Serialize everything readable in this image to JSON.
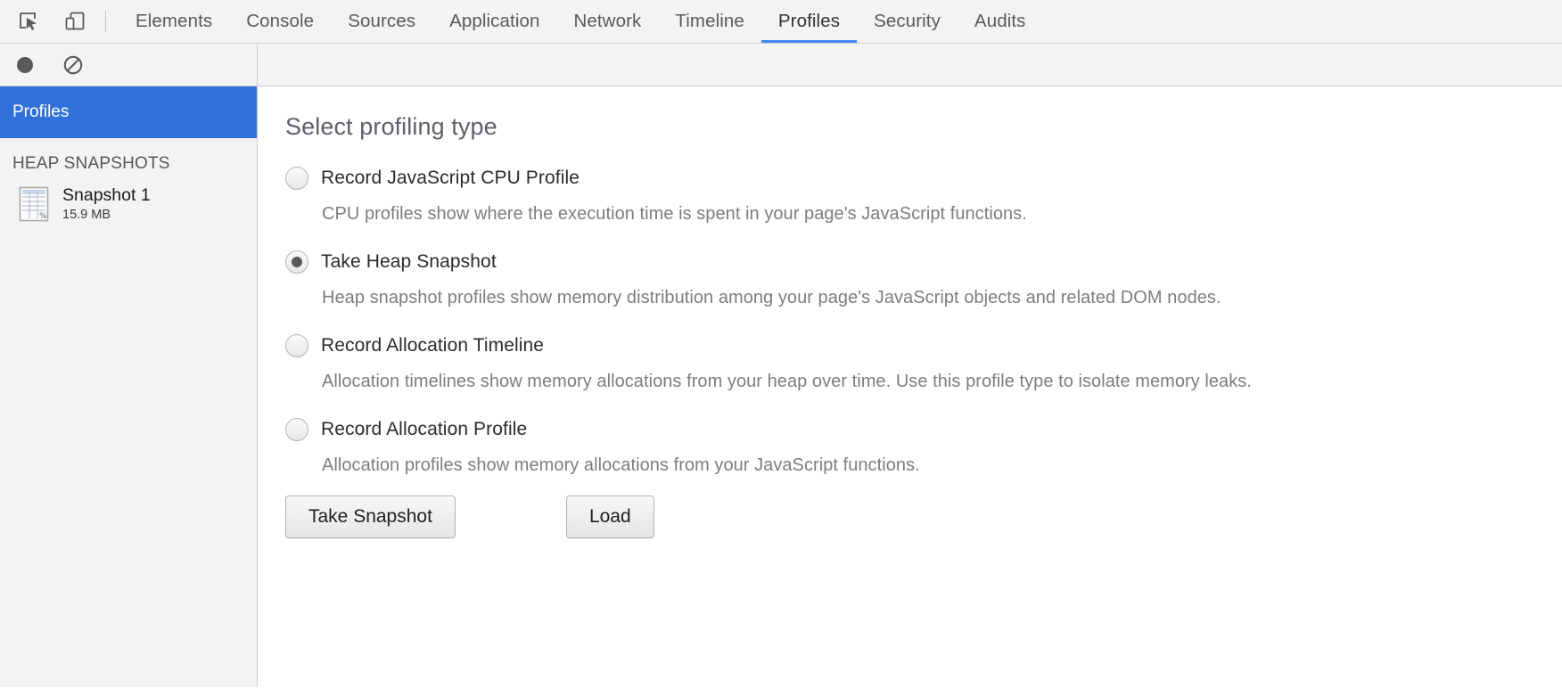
{
  "toolbar": {
    "inspect_icon": "inspect-element-icon",
    "device_icon": "toggle-device-toolbar-icon",
    "tabs": [
      {
        "label": "Elements",
        "active": false
      },
      {
        "label": "Console",
        "active": false
      },
      {
        "label": "Sources",
        "active": false
      },
      {
        "label": "Application",
        "active": false
      },
      {
        "label": "Network",
        "active": false
      },
      {
        "label": "Timeline",
        "active": false
      },
      {
        "label": "Profiles",
        "active": true
      },
      {
        "label": "Security",
        "active": false
      },
      {
        "label": "Audits",
        "active": false
      }
    ],
    "active_tab_accent": "#4285f4"
  },
  "subtoolbar": {
    "record_icon": "record-circle-icon",
    "clear_icon": "clear-all-icon"
  },
  "sidebar": {
    "header_label": "Profiles",
    "header_color": "#3072d9",
    "section_label": "HEAP SNAPSHOTS",
    "items": [
      {
        "icon": "heap-snapshot-icon",
        "title": "Snapshot 1",
        "size": "15.9 MB"
      }
    ]
  },
  "main": {
    "title": "Select profiling type",
    "options": [
      {
        "label": "Record JavaScript CPU Profile",
        "checked": false,
        "description": "CPU profiles show where the execution time is spent in your page's JavaScript functions."
      },
      {
        "label": "Take Heap Snapshot",
        "checked": true,
        "description": "Heap snapshot profiles show memory distribution among your page's JavaScript objects and related DOM nodes."
      },
      {
        "label": "Record Allocation Timeline",
        "checked": false,
        "description": "Allocation timelines show memory allocations from your heap over time. Use this profile type to isolate memory leaks."
      },
      {
        "label": "Record Allocation Profile",
        "checked": false,
        "description": "Allocation profiles show memory allocations from your JavaScript functions."
      }
    ],
    "primary_button": "Take Snapshot",
    "secondary_button": "Load"
  }
}
